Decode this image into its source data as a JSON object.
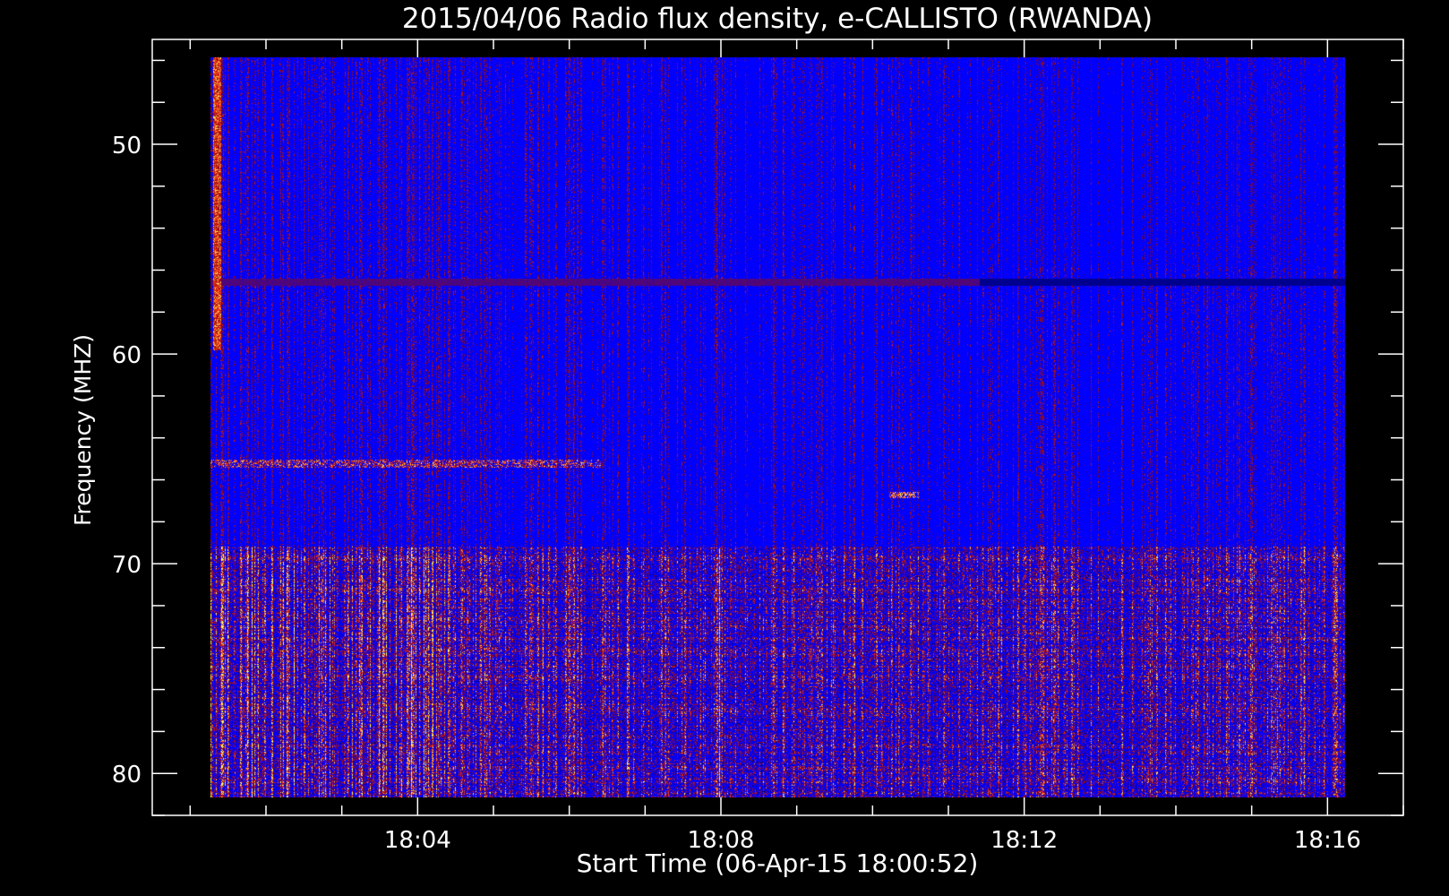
{
  "chart_data": {
    "type": "heatmap",
    "title": "2015/04/06  Radio flux density, e-CALLISTO (RWANDA)",
    "xlabel": "Start Time (06-Apr-15 18:00:52)",
    "ylabel": "Frequency (MHZ)",
    "x_ticks": [
      {
        "label": "18:04",
        "minutes": 4
      },
      {
        "label": "18:08",
        "minutes": 8
      },
      {
        "label": "18:12",
        "minutes": 12
      },
      {
        "label": "18:16",
        "minutes": 16
      }
    ],
    "y_ticks": [
      {
        "label": "50",
        "value": 50
      },
      {
        "label": "60",
        "value": 60
      },
      {
        "label": "70",
        "value": 70
      },
      {
        "label": "80",
        "value": 80
      }
    ],
    "x_range_minutes": [
      0.5,
      17.0
    ],
    "data_range_minutes": [
      1.26,
      16.22
    ],
    "y_range_mhz": [
      45.0,
      82.0
    ],
    "y_inverted": true,
    "data_range_mhz": [
      45.8,
      81.7
    ],
    "x_minor_ticks_per_major": 4,
    "y_minor_ticks_per_major": 5,
    "colormap": [
      "#000010",
      "#0000ff",
      "#8a0a10",
      "#ff3000",
      "#ffff60"
    ],
    "features": {
      "rfi_line_mhz": 56.7,
      "rfi_line_change_minute": 11.4,
      "dotted_band_mhz": 65.5,
      "dotted_band_end_minute": 6.4,
      "small_burst": {
        "mhz": 67.0,
        "start_minute": 10.2,
        "end_minute": 10.6
      },
      "noisy_region_start_mhz": 69.5,
      "bright_edge_column_minute": 1.34
    }
  }
}
